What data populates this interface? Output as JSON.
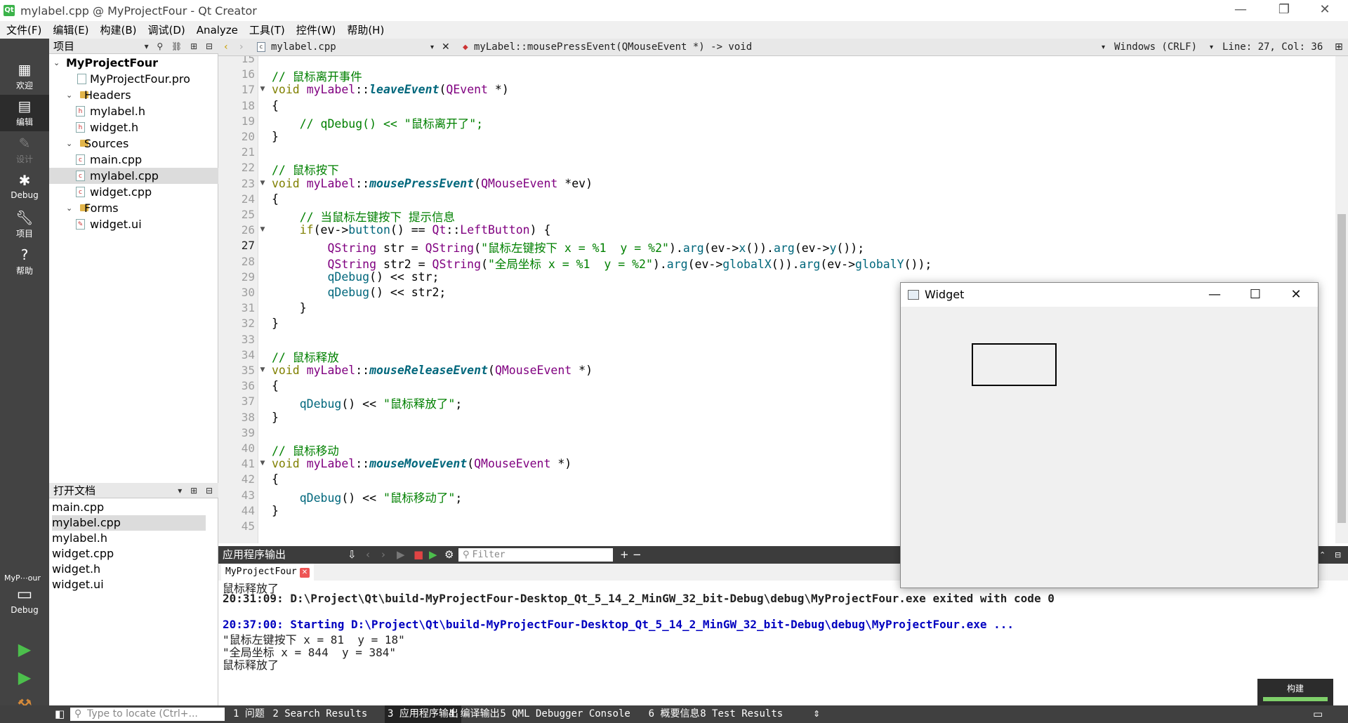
{
  "window": {
    "title": "mylabel.cpp @ MyProjectFour - Qt Creator",
    "app_icon": "qt-icon"
  },
  "menu": [
    "文件(F)",
    "编辑(E)",
    "构建(B)",
    "调试(D)",
    "Analyze",
    "工具(T)",
    "控件(W)",
    "帮助(H)"
  ],
  "modes": [
    {
      "label": "欢迎",
      "icon": "grid-icon"
    },
    {
      "label": "编辑",
      "icon": "edit-icon"
    },
    {
      "label": "设计",
      "icon": "design-icon"
    },
    {
      "label": "Debug",
      "icon": "bug-icon"
    },
    {
      "label": "项目",
      "icon": "wrench-icon"
    },
    {
      "label": "帮助",
      "icon": "help-icon"
    }
  ],
  "kit": {
    "project": "MyP⋯our",
    "config": "Debug"
  },
  "project_panel": {
    "title": "项目",
    "tree": [
      {
        "label": "MyProjectFour",
        "depth": 0,
        "kind": "project"
      },
      {
        "label": "MyProjectFour.pro",
        "depth": 1,
        "kind": "pro"
      },
      {
        "label": "Headers",
        "depth": 1,
        "kind": "folder"
      },
      {
        "label": "mylabel.h",
        "depth": 2,
        "kind": "h"
      },
      {
        "label": "widget.h",
        "depth": 2,
        "kind": "h"
      },
      {
        "label": "Sources",
        "depth": 1,
        "kind": "folder"
      },
      {
        "label": "main.cpp",
        "depth": 2,
        "kind": "cpp"
      },
      {
        "label": "mylabel.cpp",
        "depth": 2,
        "kind": "cpp",
        "selected": true
      },
      {
        "label": "widget.cpp",
        "depth": 2,
        "kind": "cpp"
      },
      {
        "label": "Forms",
        "depth": 1,
        "kind": "folder"
      },
      {
        "label": "widget.ui",
        "depth": 2,
        "kind": "ui"
      }
    ]
  },
  "open_docs": {
    "title": "打开文档",
    "items": [
      "main.cpp",
      "mylabel.cpp",
      "mylabel.h",
      "widget.cpp",
      "widget.h",
      "widget.ui"
    ],
    "selected": "mylabel.cpp"
  },
  "editor_toolbar": {
    "file": "mylabel.cpp",
    "symbol": "myLabel::mousePressEvent(QMouseEvent *) -> void",
    "encoding": "Windows (CRLF)",
    "position": "Line: 27, Col: 36"
  },
  "editor": {
    "current_line": 27,
    "lines": [
      {
        "n": 15,
        "t": ""
      },
      {
        "n": 16,
        "t": "// 鼠标离开事件"
      },
      {
        "n": 17,
        "t": "void myLabel::leaveEvent(QEvent *)",
        "fold": true
      },
      {
        "n": 18,
        "t": "{"
      },
      {
        "n": 19,
        "t": "    // qDebug() << \"鼠标离开了\";"
      },
      {
        "n": 20,
        "t": "}"
      },
      {
        "n": 21,
        "t": ""
      },
      {
        "n": 22,
        "t": "// 鼠标按下"
      },
      {
        "n": 23,
        "t": "void myLabel::mousePressEvent(QMouseEvent *ev)",
        "fold": true
      },
      {
        "n": 24,
        "t": "{"
      },
      {
        "n": 25,
        "t": "    // 当鼠标左键按下 提示信息"
      },
      {
        "n": 26,
        "t": "    if(ev->button() == Qt::LeftButton) {",
        "fold": true
      },
      {
        "n": 27,
        "t": "        QString str = QString(\"鼠标左键按下 x = %1  y = %2\").arg(ev->x()).arg(ev->y());"
      },
      {
        "n": 28,
        "t": "        QString str2 = QString(\"全局坐标 x = %1  y = %2\").arg(ev->globalX()).arg(ev->globalY());"
      },
      {
        "n": 29,
        "t": "        qDebug() << str;"
      },
      {
        "n": 30,
        "t": "        qDebug() << str2;"
      },
      {
        "n": 31,
        "t": "    }"
      },
      {
        "n": 32,
        "t": "}"
      },
      {
        "n": 33,
        "t": ""
      },
      {
        "n": 34,
        "t": "// 鼠标释放"
      },
      {
        "n": 35,
        "t": "void myLabel::mouseReleaseEvent(QMouseEvent *)",
        "fold": true
      },
      {
        "n": 36,
        "t": "{"
      },
      {
        "n": 37,
        "t": "    qDebug() << \"鼠标释放了\";"
      },
      {
        "n": 38,
        "t": "}"
      },
      {
        "n": 39,
        "t": ""
      },
      {
        "n": 40,
        "t": "// 鼠标移动"
      },
      {
        "n": 41,
        "t": "void myLabel::mouseMoveEvent(QMouseEvent *)",
        "fold": true
      },
      {
        "n": 42,
        "t": "{"
      },
      {
        "n": 43,
        "t": "    qDebug() << \"鼠标移动了\";"
      },
      {
        "n": 44,
        "t": "}"
      },
      {
        "n": 45,
        "t": ""
      }
    ]
  },
  "output_panel": {
    "title": "应用程序输出",
    "filter_placeholder": "Filter",
    "tab": "MyProjectFour",
    "lines": [
      {
        "t": "鼠标释放了",
        "style": "plain"
      },
      {
        "t": "20:31:09: D:\\Project\\Qt\\build-MyProjectFour-Desktop_Qt_5_14_2_MinGW_32_bit-Debug\\debug\\MyProjectFour.exe exited with code 0",
        "style": "bold"
      },
      {
        "t": "",
        "style": "plain"
      },
      {
        "t": "20:37:00: Starting D:\\Project\\Qt\\build-MyProjectFour-Desktop_Qt_5_14_2_MinGW_32_bit-Debug\\debug\\MyProjectFour.exe ...",
        "style": "blue"
      },
      {
        "t": "\"鼠标左键按下 x = 81  y = 18\"",
        "style": "plain"
      },
      {
        "t": "\"全局坐标 x = 844  y = 384\"",
        "style": "plain"
      },
      {
        "t": "鼠标释放了",
        "style": "plain"
      }
    ]
  },
  "build_progress": {
    "label": "构建",
    "value": 1.0,
    "color": "#7fd06a"
  },
  "statusbar": {
    "locator_placeholder": "Type to locate (Ctrl+...",
    "panes": [
      "1 问题",
      "2 Search Results",
      "3 应用程序输出",
      "4 编译输出",
      "5 QML Debugger Console",
      "6 概要信息",
      "8 Test Results"
    ]
  },
  "widget_window": {
    "title": "Widget",
    "min": "—",
    "max": "☐",
    "close": "✕"
  }
}
